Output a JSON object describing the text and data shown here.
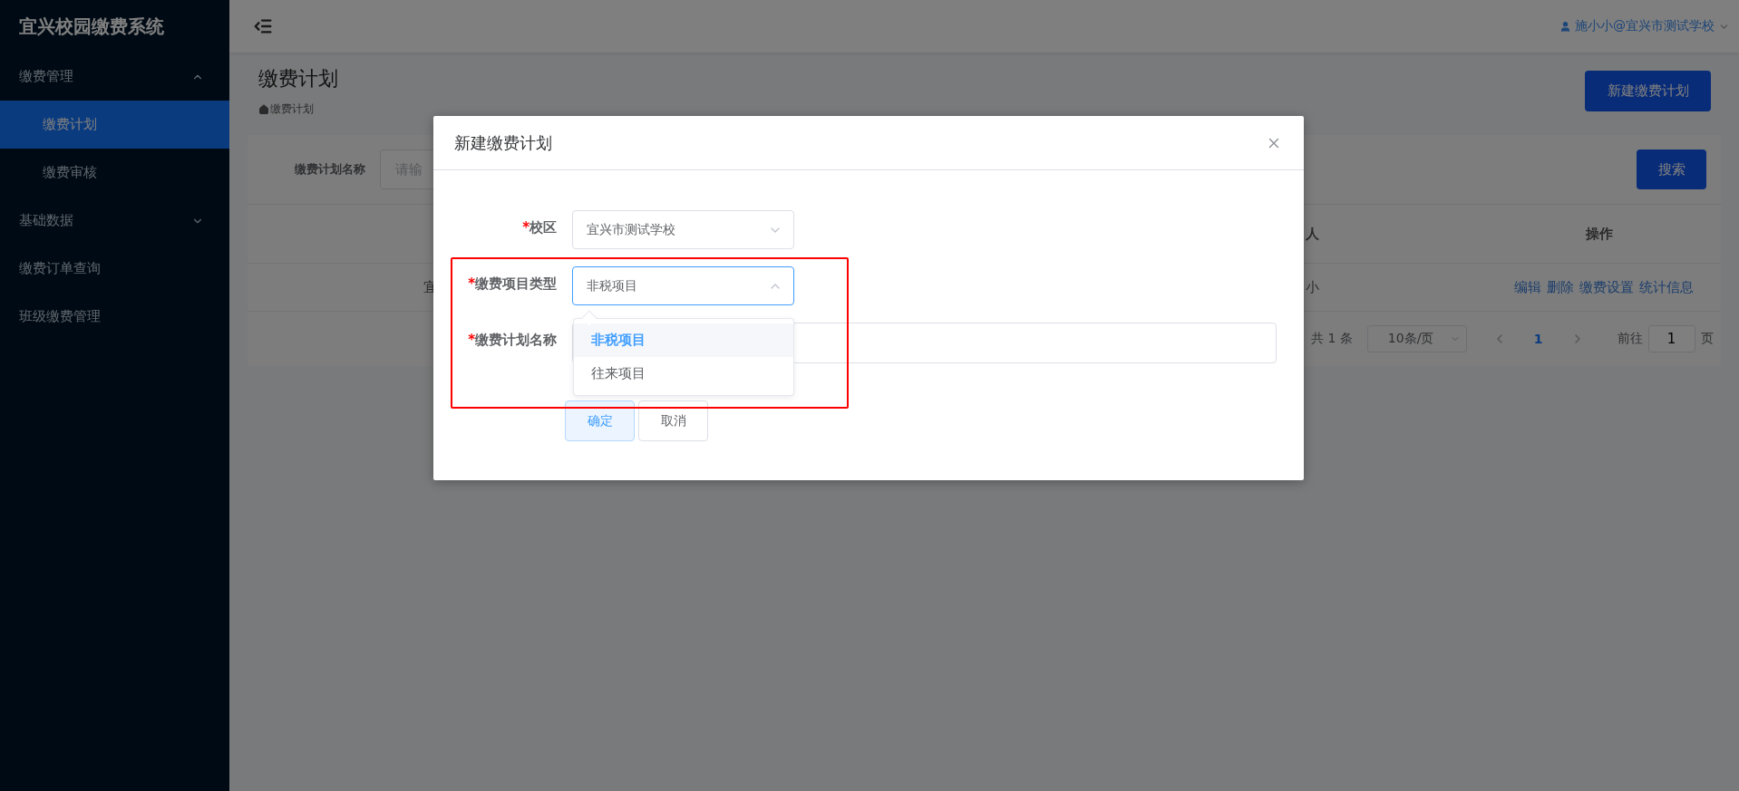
{
  "sidebar": {
    "logo": "宜兴校园缴费系统",
    "items": [
      {
        "kind": "group",
        "label": "缴费管理",
        "expanded": true,
        "children": [
          {
            "label": "缴费计划",
            "selected": true
          },
          {
            "label": "缴费审核",
            "selected": false
          }
        ]
      },
      {
        "kind": "group",
        "label": "基础数据",
        "expanded": false
      },
      {
        "kind": "link",
        "label": "缴费订单查询"
      },
      {
        "kind": "link",
        "label": "班级缴费管理"
      }
    ]
  },
  "header": {
    "user": "施小小@宜兴市测试学校"
  },
  "page": {
    "title": "缴费计划",
    "breadcrumb": "缴费计划",
    "new_button": "新建缴费计划"
  },
  "search": {
    "label": "缴费计划名称",
    "placeholder": "请输",
    "button": "搜索"
  },
  "table": {
    "columns": [
      "",
      "人",
      "操作"
    ],
    "rows": [
      {
        "cells": [
          "宜",
          "小"
        ],
        "actions": [
          "编辑",
          "删除",
          "缴费设置",
          "统计信息"
        ]
      }
    ]
  },
  "pagination": {
    "total": "共 1 条",
    "page_size": "10条/页",
    "pages": [
      {
        "label": "1",
        "selected": true
      }
    ],
    "goto_label": "前往",
    "goto_value": "1",
    "page_unit": "页"
  },
  "dialog": {
    "title": "新建缴费计划",
    "required_mark": "*",
    "fields": [
      {
        "kind": "select",
        "label": "校区",
        "required": true,
        "value": "宜兴市测试学校",
        "open": false
      },
      {
        "kind": "select",
        "label": "缴费项目类型",
        "required": true,
        "value": "非税项目",
        "open": true,
        "options": [
          {
            "label": "非税项目",
            "selected": true
          },
          {
            "label": "往来项目",
            "selected": false
          }
        ]
      },
      {
        "kind": "text",
        "label": "缴费计划名称",
        "required": true
      }
    ],
    "buttons": [
      {
        "label": "确定",
        "kind": "primary"
      },
      {
        "label": "取消",
        "kind": "default"
      }
    ]
  }
}
